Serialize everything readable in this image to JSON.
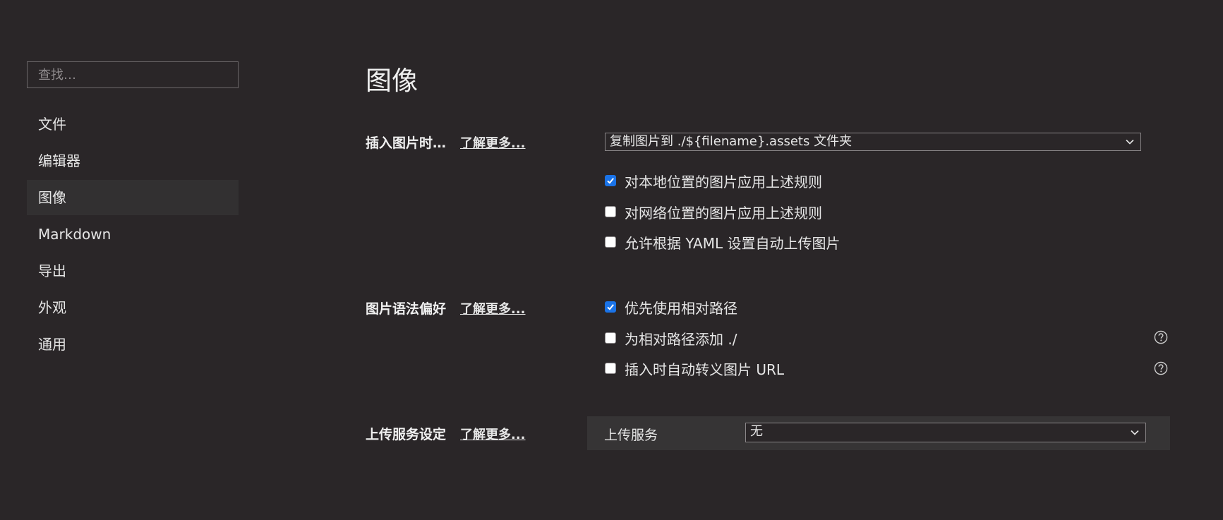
{
  "sidebar": {
    "search_placeholder": "查找…",
    "items": [
      {
        "label": "文件",
        "active": false
      },
      {
        "label": "编辑器",
        "active": false
      },
      {
        "label": "图像",
        "active": true
      },
      {
        "label": "Markdown",
        "active": false
      },
      {
        "label": "导出",
        "active": false
      },
      {
        "label": "外观",
        "active": false
      },
      {
        "label": "通用",
        "active": false
      }
    ]
  },
  "main": {
    "title": "图像",
    "insert_section": {
      "label": "插入图片时…",
      "learn_more": "了解更多...",
      "select_value": "复制图片到 ./${filename}.assets 文件夹",
      "options": [
        {
          "label": "对本地位置的图片应用上述规则",
          "checked": true
        },
        {
          "label": "对网络位置的图片应用上述规则",
          "checked": false
        },
        {
          "label": "允许根据 YAML 设置自动上传图片",
          "checked": false
        }
      ]
    },
    "syntax_section": {
      "label": "图片语法偏好",
      "learn_more": "了解更多...",
      "options": [
        {
          "label": "优先使用相对路径",
          "checked": true,
          "help": false
        },
        {
          "label": "为相对路径添加 ./",
          "checked": false,
          "help": true
        },
        {
          "label": "插入时自动转义图片 URL",
          "checked": false,
          "help": true
        }
      ]
    },
    "upload_section": {
      "label": "上传服务设定",
      "learn_more": "了解更多...",
      "service_label": "上传服务",
      "service_value": "无"
    }
  },
  "colors": {
    "background": "#2a2628",
    "active_item": "#323031",
    "panel": "#363435",
    "checkbox_accent": "#1a73e8"
  }
}
